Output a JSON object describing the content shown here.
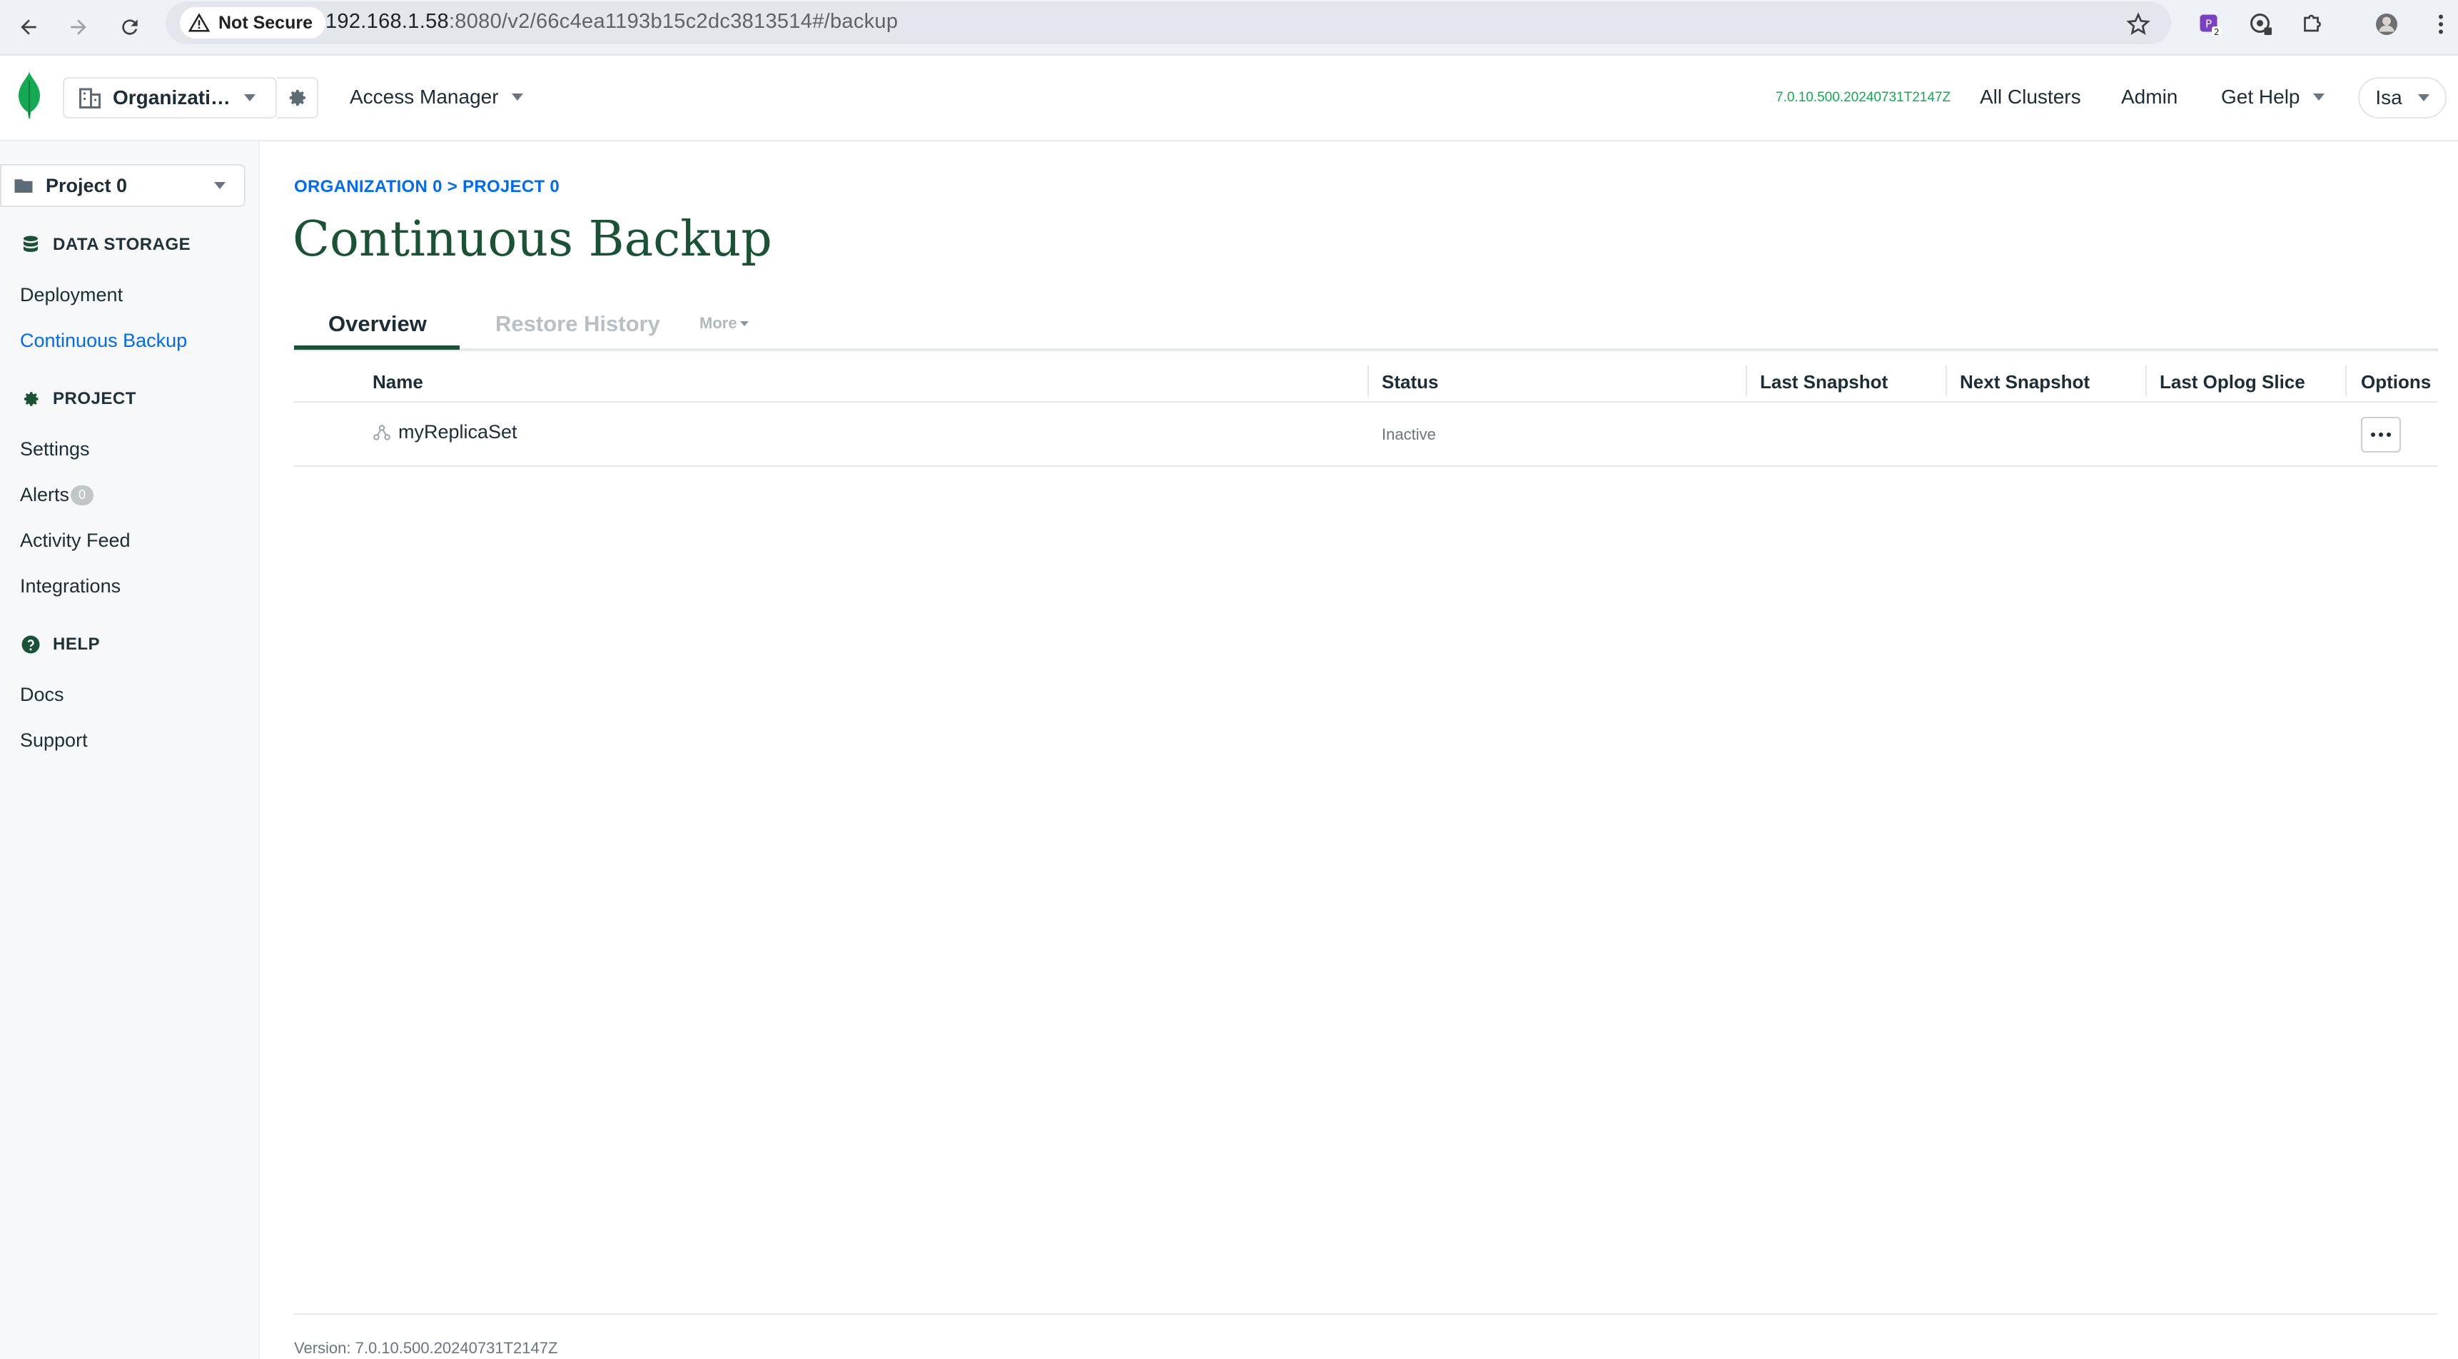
{
  "browser": {
    "security_label": "Not Secure",
    "url_host": "192.168.1.58",
    "url_rest": ":8080/v2/66c4ea1193b15c2dc3813514#/backup",
    "extension_badge": "2"
  },
  "header": {
    "org_name": "Organizatio...",
    "access_manager": "Access Manager",
    "version_badge": "7.0.10.500.20240731T2147Z",
    "all_clusters": "All Clusters",
    "admin": "Admin",
    "get_help": "Get Help",
    "user": "Isa"
  },
  "sidebar": {
    "project": "Project 0",
    "sections": [
      {
        "title": "DATA STORAGE",
        "icon": "database-icon",
        "items": [
          {
            "label": "Deployment"
          },
          {
            "label": "Continuous Backup",
            "active": true
          }
        ]
      },
      {
        "title": "PROJECT",
        "icon": "gear-icon",
        "items": [
          {
            "label": "Settings"
          },
          {
            "label": "Alerts",
            "badge": "0"
          },
          {
            "label": "Activity Feed"
          },
          {
            "label": "Integrations"
          }
        ]
      },
      {
        "title": "HELP",
        "icon": "help-icon",
        "items": [
          {
            "label": "Docs"
          },
          {
            "label": "Support"
          }
        ]
      }
    ]
  },
  "main": {
    "breadcrumb": "ORGANIZATION 0 > PROJECT 0",
    "title": "Continuous Backup",
    "tabs": [
      {
        "label": "Overview",
        "active": true
      },
      {
        "label": "Restore History"
      }
    ],
    "more_label": "More",
    "table": {
      "headers": [
        "Name",
        "Status",
        "Last Snapshot",
        "Next Snapshot",
        "Last Oplog Slice",
        "Options"
      ],
      "rows": [
        {
          "name": "myReplicaSet",
          "status": "Inactive",
          "last_snapshot": "",
          "next_snapshot": "",
          "last_oplog_slice": ""
        }
      ]
    }
  },
  "footer": {
    "version": "Version: 7.0.10.500.20240731T2147Z"
  },
  "colors": {
    "brand_green": "#13aa52",
    "title_green": "#1a5236",
    "link_blue": "#016bf8"
  }
}
